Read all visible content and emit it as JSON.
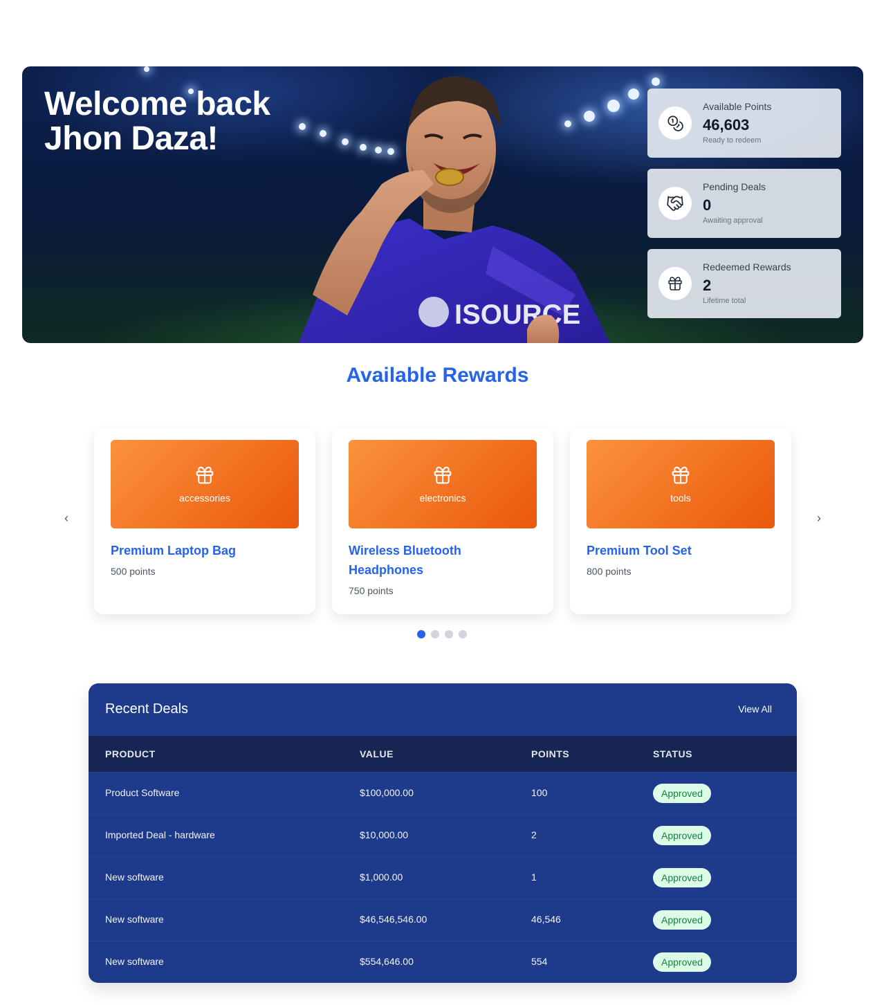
{
  "hero": {
    "title_line1": "Welcome back",
    "title_line2": "Jhon Daza!",
    "jersey_text": "ISOURCE",
    "stats": [
      {
        "label": "Available Points",
        "value": "46,603",
        "sub": "Ready to redeem",
        "icon": "coins-icon"
      },
      {
        "label": "Pending Deals",
        "value": "0",
        "sub": "Awaiting approval",
        "icon": "handshake-icon"
      },
      {
        "label": "Redeemed Rewards",
        "value": "2",
        "sub": "Lifetime total",
        "icon": "gift-icon"
      }
    ]
  },
  "rewards": {
    "title": "Available Rewards",
    "items": [
      {
        "category": "accessories",
        "name": "Premium Laptop Bag",
        "points": "500 points"
      },
      {
        "category": "electronics",
        "name": "Wireless Bluetooth Headphones",
        "points": "750 points"
      },
      {
        "category": "tools",
        "name": "Premium Tool Set",
        "points": "800 points"
      }
    ],
    "prev_icon": "chevron-left-icon",
    "next_icon": "chevron-right-icon",
    "active_page": 1,
    "page_count": 4
  },
  "deals": {
    "title": "Recent Deals",
    "view_all": "View All",
    "columns": [
      "PRODUCT",
      "VALUE",
      "POINTS",
      "STATUS"
    ],
    "rows": [
      {
        "product": "Product Software",
        "value": "$100,000.00",
        "points": "100",
        "status": "Approved"
      },
      {
        "product": "Imported Deal - hardware",
        "value": "$10,000.00",
        "points": "2",
        "status": "Approved"
      },
      {
        "product": "New software",
        "value": "$1,000.00",
        "points": "1",
        "status": "Approved"
      },
      {
        "product": "New software",
        "value": "$46,546,546.00",
        "points": "46,546",
        "status": "Approved"
      },
      {
        "product": "New software",
        "value": "$554,646.00",
        "points": "554",
        "status": "Approved"
      }
    ]
  },
  "colors": {
    "accent": "#2563eb",
    "orange": "#ea580c",
    "deals_bg": "#1e3a8a",
    "header_bg": "#172554",
    "badge_bg": "#dcfce7",
    "badge_text": "#15803d"
  }
}
